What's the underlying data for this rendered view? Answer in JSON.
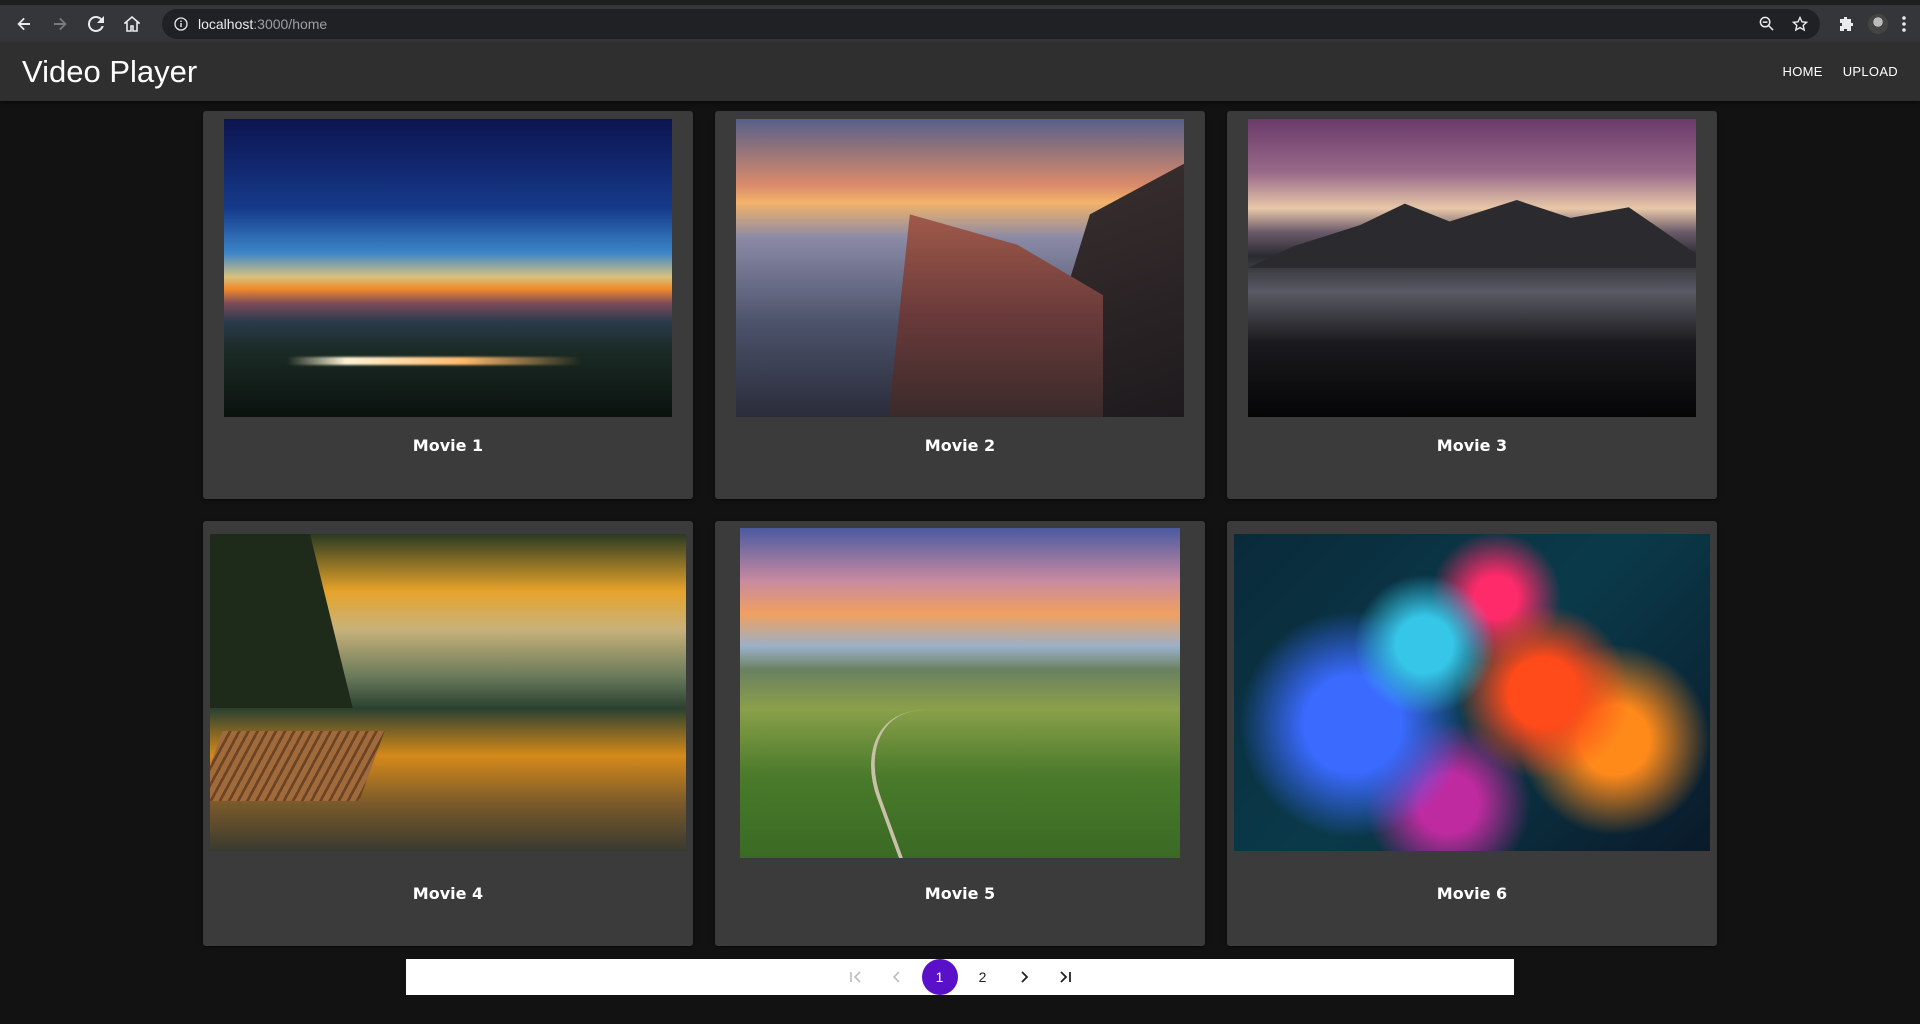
{
  "browser": {
    "url_host": "localhost",
    "url_path": ":3000/home",
    "back_icon": "arrow-left-icon",
    "forward_icon": "arrow-right-icon",
    "reload_icon": "reload-icon",
    "home_icon": "home-icon"
  },
  "app": {
    "title": "Video Player",
    "nav": [
      {
        "label": "HOME"
      },
      {
        "label": "UPLOAD"
      }
    ]
  },
  "movies": [
    {
      "title": "Movie 1"
    },
    {
      "title": "Movie 2"
    },
    {
      "title": "Movie 3"
    },
    {
      "title": "Movie 4"
    },
    {
      "title": "Movie 5"
    },
    {
      "title": "Movie 6"
    }
  ],
  "pagination": {
    "pages": [
      "1",
      "2"
    ],
    "current": "1",
    "accent": "#5a0fc8"
  }
}
